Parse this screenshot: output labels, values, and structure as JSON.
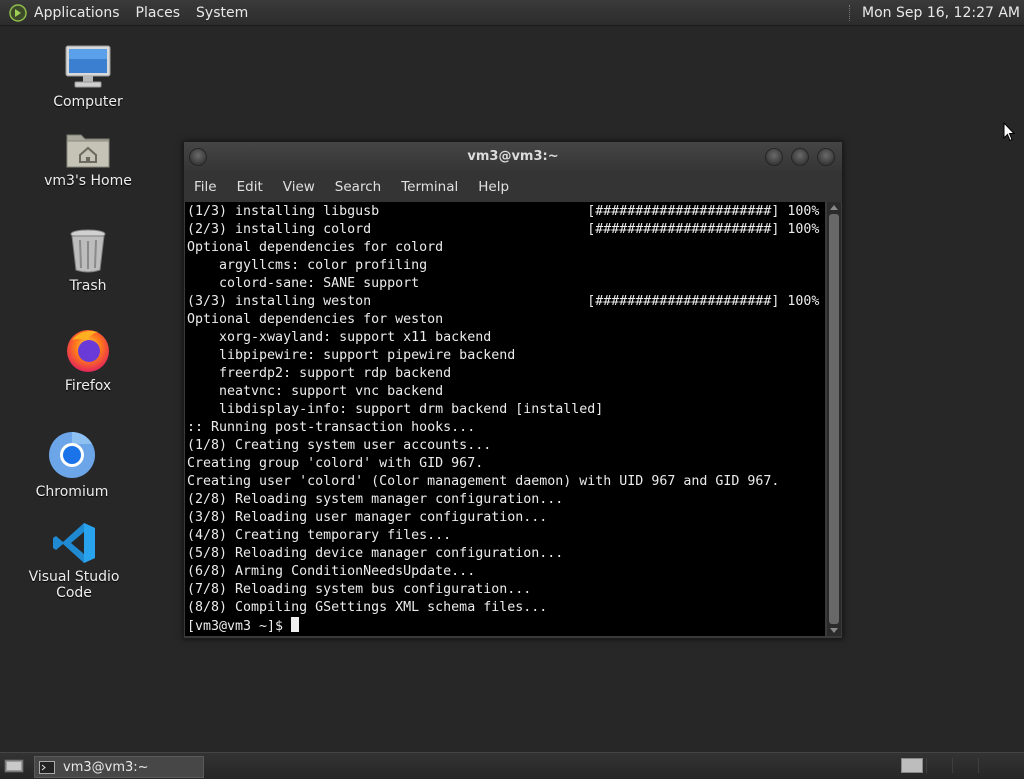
{
  "top_panel": {
    "menus": [
      "Applications",
      "Places",
      "System"
    ],
    "clock": "Mon Sep 16, 12:27 AM",
    "logo_icon": "mate-logo-icon"
  },
  "desktop_icons": [
    {
      "label": "Computer",
      "icon": "computer-icon"
    },
    {
      "label": "vm3's Home",
      "icon": "home-folder-icon"
    },
    {
      "label": "Trash",
      "icon": "trash-icon"
    },
    {
      "label": "Firefox",
      "icon": "firefox-icon"
    },
    {
      "label": "Chromium",
      "icon": "chromium-icon"
    },
    {
      "label": "Visual Studio Code",
      "icon": "vscode-icon"
    }
  ],
  "terminal": {
    "title": "vm3@vm3:~",
    "menu": [
      "File",
      "Edit",
      "View",
      "Search",
      "Terminal",
      "Help"
    ],
    "lines": [
      "(1/3) installing libgusb                          [######################] 100%",
      "(2/3) installing colord                           [######################] 100%",
      "Optional dependencies for colord",
      "    argyllcms: color profiling",
      "    colord-sane: SANE support",
      "(3/3) installing weston                           [######################] 100%",
      "Optional dependencies for weston",
      "    xorg-xwayland: support x11 backend",
      "    libpipewire: support pipewire backend",
      "    freerdp2: support rdp backend",
      "    neatvnc: support vnc backend",
      "    libdisplay-info: support drm backend [installed]",
      ":: Running post-transaction hooks...",
      "(1/8) Creating system user accounts...",
      "Creating group 'colord' with GID 967.",
      "Creating user 'colord' (Color management daemon) with UID 967 and GID 967.",
      "(2/8) Reloading system manager configuration...",
      "(3/8) Reloading user manager configuration...",
      "(4/8) Creating temporary files...",
      "(5/8) Reloading device manager configuration...",
      "(6/8) Arming ConditionNeedsUpdate...",
      "(7/8) Reloading system bus configuration...",
      "(8/8) Compiling GSettings XML schema files..."
    ],
    "prompt": "[vm3@vm3 ~]$ "
  },
  "taskbar": {
    "window_button": "vm3@vm3:~"
  },
  "colors": {
    "desktop_bg": "#272727",
    "terminal_bg": "#000000",
    "terminal_fg": "#ececec"
  }
}
